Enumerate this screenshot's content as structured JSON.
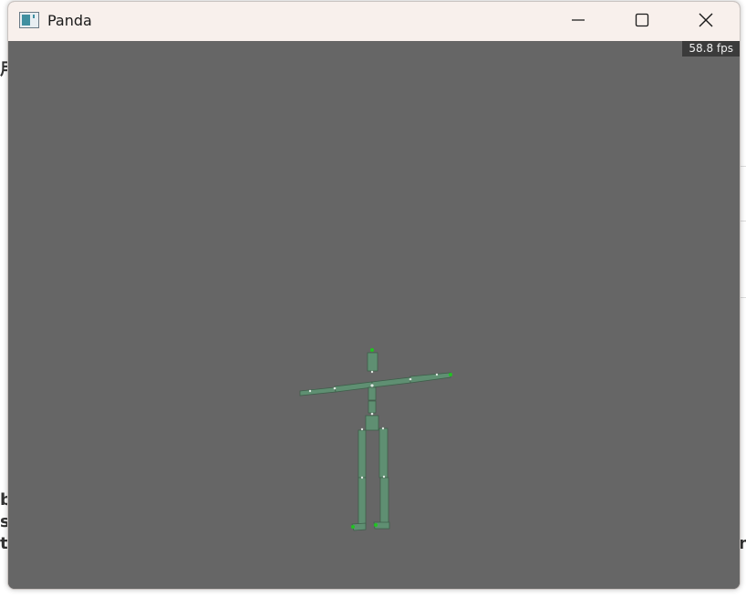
{
  "window": {
    "title": "Panda",
    "minimize_icon": "minimize-icon",
    "maximize_icon": "maximize-icon",
    "close_icon": "close-icon"
  },
  "viewport": {
    "fps_label": "58.8 fps",
    "background_color": "#666666",
    "model_color": "#5f8f72",
    "joint_color": "#22c322"
  },
  "background_fragments": [
    "用",
    "b",
    "s",
    "t",
    "n"
  ]
}
